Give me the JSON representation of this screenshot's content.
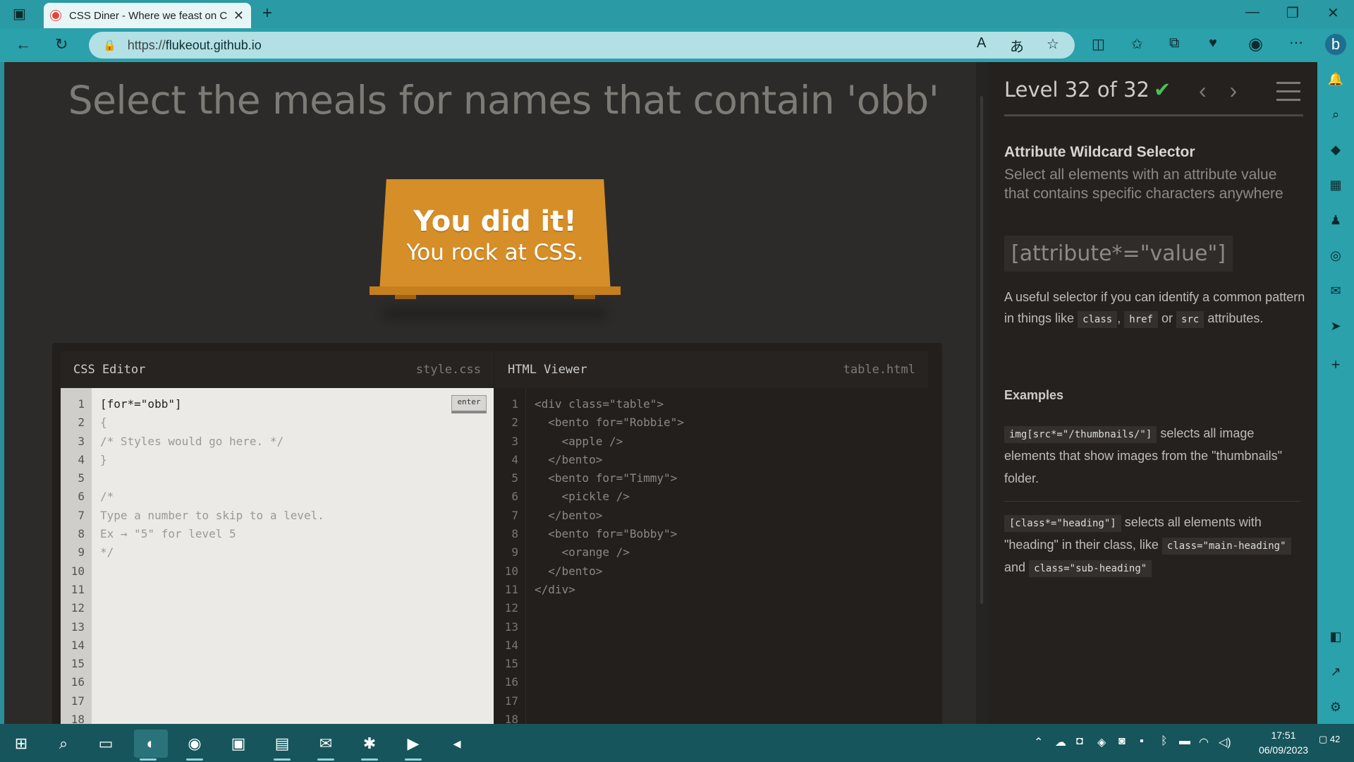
{
  "browser": {
    "tab_title": "CSS Diner - Where we feast on C",
    "url_protocol": "https://",
    "url_host": "flukeout.github.io"
  },
  "page": {
    "instruction": "Select the meals for names that contain 'obb'",
    "table_message_big": "You did it!",
    "table_message_small": "You rock at CSS."
  },
  "css_editor": {
    "title": "CSS Editor",
    "file": "style.css",
    "enter_label": "enter",
    "line_numbers": "1\n2\n3\n4\n5\n6\n7\n8\n9\n10\n11\n12\n13\n14\n15\n16\n17\n18",
    "input_line": "[for*=\"obb\"]",
    "comment_text": "{\n/* Styles would go here. */\n}\n\n/*\nType a number to skip to a level.\nEx → \"5\" for level 5\n*/"
  },
  "html_viewer": {
    "title": "HTML Viewer",
    "file": "table.html",
    "line_numbers": "1\n2\n3\n4\n5\n6\n7\n8\n9\n10\n11\n12\n13\n14\n15\n16\n17\n18",
    "code": "<div class=\"table\">\n  <bento for=\"Robbie\">\n    <apple />\n  </bento>\n  <bento for=\"Timmy\">\n    <pickle />\n  </bento>\n  <bento for=\"Bobby\">\n    <orange />\n  </bento>\n</div>"
  },
  "sidebar": {
    "level_label": "Level 32 of 32",
    "check": "✔",
    "selector_name": "Attribute Wildcard Selector",
    "selector_desc": "Select all elements with an attribute value that contains specific characters anywhere",
    "syntax": "[attribute*=\"value\"]",
    "hint_pre": "A useful selector if you can identify a common pattern in things like",
    "hint_kw1": "class",
    "hint_comma": ",",
    "hint_kw2": "href",
    "hint_or": "or",
    "hint_kw3": "src",
    "hint_post": "attributes.",
    "examples_heading": "Examples",
    "ex1_code": "img[src*=\"/thumbnails/\"]",
    "ex1_text": "selects all image elements that show images from the \"thumbnails\" folder.",
    "ex2_code": "[class*=\"heading\"]",
    "ex2_text": "selects all elements with \"heading\" in their class, like",
    "ex2_code2": "class=\"main-heading\"",
    "ex2_and": "and",
    "ex2_code3": "class=\"sub-heading\""
  },
  "taskbar": {
    "time": "17:51",
    "date": "06/09/2023",
    "notification_count": "42"
  },
  "colors": {
    "accent": "#2aa1ab",
    "table": "#d58e28",
    "check": "#4bc051"
  }
}
